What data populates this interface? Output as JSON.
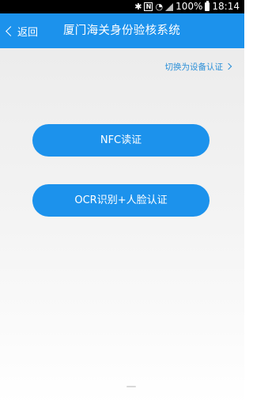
{
  "status_bar": {
    "icons": [
      "bluetooth-icon",
      "nfc-icon",
      "wifi-icon",
      "signal-icon",
      "battery-icon"
    ],
    "battery": "100%",
    "time": "18:14"
  },
  "header": {
    "back_label": "返回",
    "title": "厦门海关身份验核系统",
    "color": "#1c92ec"
  },
  "main": {
    "switch_link": "切换为设备认证",
    "nfc_button": "NFC读证",
    "ocr_button": "OCR识别+人脸认证"
  }
}
